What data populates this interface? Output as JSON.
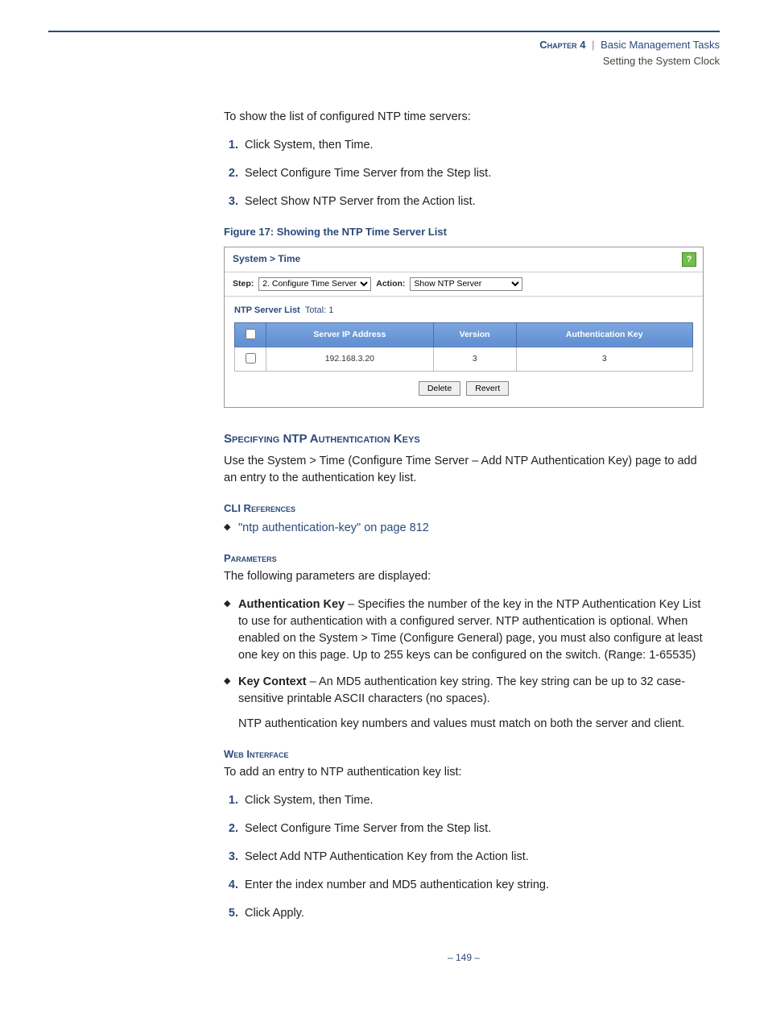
{
  "header": {
    "chapter": "Chapter 4",
    "title": "Basic Management Tasks",
    "subtitle": "Setting the System Clock"
  },
  "intro": "To show the list of configured NTP time servers:",
  "steps1": [
    "Click System, then Time.",
    "Select Configure Time Server from the Step list.",
    "Select Show NTP Server from the Action list."
  ],
  "figure": {
    "caption": "Figure 17:  Showing the NTP Time Server List",
    "breadcrumb": "System > Time",
    "step_label": "Step:",
    "step_value": "2. Configure Time Server",
    "action_label": "Action:",
    "action_value": "Show NTP Server",
    "list_label": "NTP Server List",
    "total_label": "Total: 1",
    "columns": [
      "Server IP Address",
      "Version",
      "Authentication Key"
    ],
    "rows": [
      {
        "ip": "192.168.3.20",
        "version": "3",
        "authkey": "3"
      }
    ],
    "buttons": {
      "delete": "Delete",
      "revert": "Revert"
    }
  },
  "section2": {
    "heading": "Specifying NTP Authentication Keys",
    "intro": "Use the System > Time (Configure Time Server – Add NTP Authentication Key) page to add an entry to the authentication key list.",
    "cli_heading": "CLI References",
    "cli_link": "\"ntp authentication-key\" on page 812",
    "params_heading": "Parameters",
    "params_intro": "The following parameters are displayed:",
    "params": [
      {
        "name": "Authentication Key",
        "desc": " – Specifies the number of the key in the NTP Authentication Key List to use for authentication with a configured server. NTP authentication is optional. When enabled on the System > Time (Configure General) page, you must also configure at least one key on this page. Up to 255 keys can be configured on the switch. (Range: 1-65535)"
      },
      {
        "name": "Key Context",
        "desc": " – An MD5 authentication key string. The key string can be up to 32 case-sensitive printable ASCII characters (no spaces).",
        "extra": "NTP authentication key numbers and values must match on both the server and client."
      }
    ],
    "web_heading": "Web Interface",
    "web_intro": "To add an entry to NTP authentication key list:",
    "steps2": [
      "Click System, then Time.",
      "Select Configure Time Server from the Step list.",
      "Select Add NTP Authentication Key from the Action list.",
      "Enter the index number and MD5 authentication key string.",
      "Click Apply."
    ]
  },
  "footer": "–  149  –"
}
